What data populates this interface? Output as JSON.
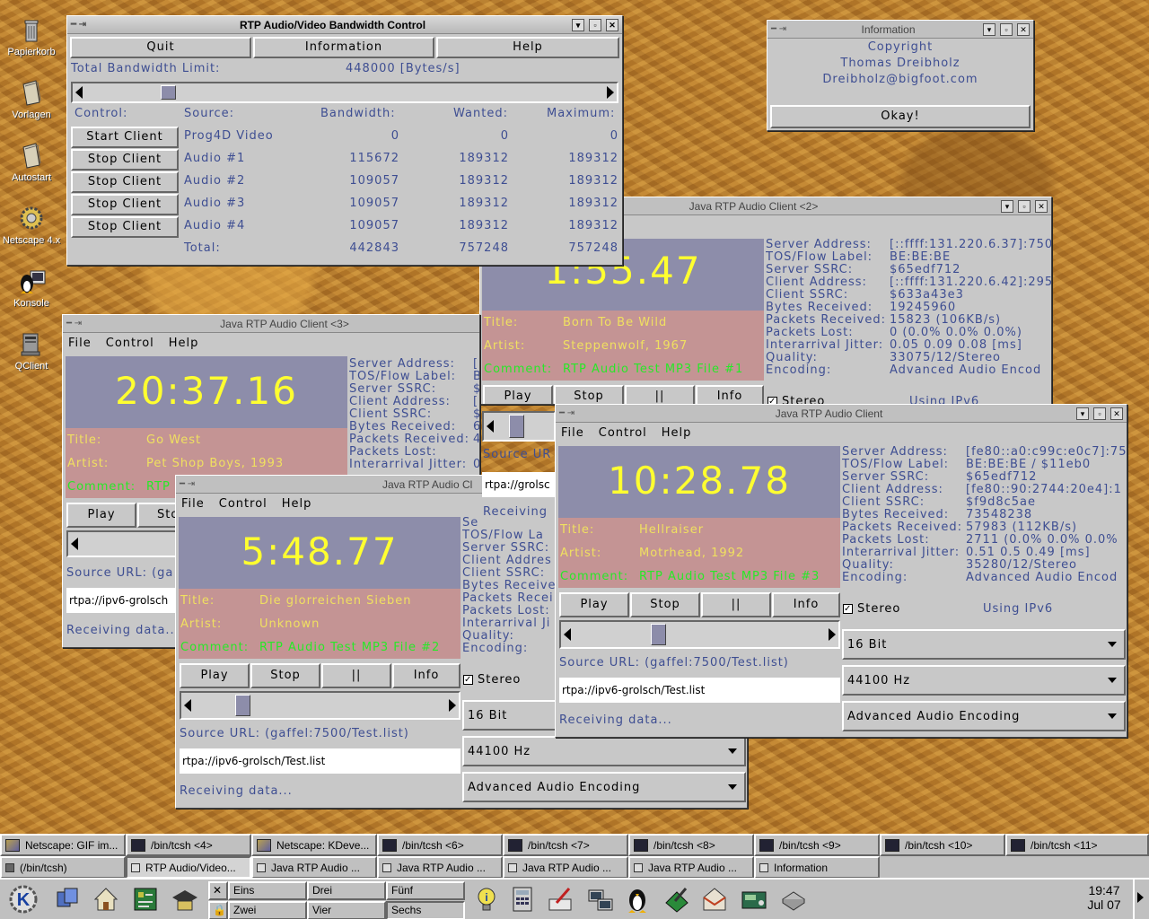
{
  "desktop": {
    "icons": [
      {
        "label": "Papierkorb"
      },
      {
        "label": "Vorlagen"
      },
      {
        "label": "Autostart"
      },
      {
        "label": "Netscape 4.x"
      },
      {
        "label": "Konsole"
      },
      {
        "label": "QClient"
      }
    ]
  },
  "bandwidth": {
    "title": "RTP Audio/Video Bandwidth Control",
    "buttons": {
      "quit": "Quit",
      "information": "Information",
      "help": "Help"
    },
    "limit_label": "Total Bandwidth Limit:",
    "limit_value": "448000 [Bytes/s]",
    "headers": {
      "control": "Control:",
      "source": "Source:",
      "bandwidth": "Bandwidth:",
      "wanted": "Wanted:",
      "maximum": "Maximum:"
    },
    "rows": [
      {
        "button": "Start Client",
        "source": "Prog4D Video",
        "bandwidth": "0",
        "wanted": "0",
        "maximum": "0"
      },
      {
        "button": "Stop Client",
        "source": "Audio #1",
        "bandwidth": "115672",
        "wanted": "189312",
        "maximum": "189312"
      },
      {
        "button": "Stop Client",
        "source": "Audio #2",
        "bandwidth": "109057",
        "wanted": "189312",
        "maximum": "189312"
      },
      {
        "button": "Stop Client",
        "source": "Audio #3",
        "bandwidth": "109057",
        "wanted": "189312",
        "maximum": "189312"
      },
      {
        "button": "Stop Client",
        "source": "Audio #4",
        "bandwidth": "109057",
        "wanted": "189312",
        "maximum": "189312"
      }
    ],
    "total": {
      "label": "Total:",
      "bandwidth": "442843",
      "wanted": "757248",
      "maximum": "757248"
    }
  },
  "information": {
    "title": "Information",
    "lines": [
      "Copyright",
      "Thomas Dreibholz",
      "Dreibholz@bigfoot.com"
    ],
    "ok": "Okay!"
  },
  "menu": {
    "file": "File",
    "control": "Control",
    "help": "Help"
  },
  "controls": {
    "play": "Play",
    "stop": "Stop",
    "pause": "||",
    "info": "Info"
  },
  "meta_keys": {
    "title": "Title:",
    "artist": "Artist:",
    "comment": "Comment:"
  },
  "info_keys": {
    "server_address": "Server Address:",
    "tos": "TOS/Flow Label:",
    "server_ssrc": "Server SSRC:",
    "client_address": "Client Address:",
    "client_ssrc": "Client SSRC:",
    "bytes": "Bytes Received:",
    "packets": "Packets Received:",
    "lost": "Packets Lost:",
    "jitter": "Interarrival Jitter:",
    "quality": "Quality:",
    "encoding": "Encoding:"
  },
  "common": {
    "source_url_label": "Source URL: (gaffel:7500/Test.list)",
    "source_url_label_short": "Source URL: (ga",
    "url": "rtpa://ipv6-grolsch/Test.list",
    "url_short": "rtpa://ipv6-grolsch",
    "url_short2": "rtpa://grolsc",
    "receiving": "Receiving data...",
    "stereo": "Stereo",
    "ipv6": "Using IPv6",
    "bits": "16 Bit",
    "rate": "44100 Hz",
    "encoding": "Advanced Audio Encoding",
    "source_short": "Source UR",
    "receiving_short": "Receiving"
  },
  "client2": {
    "title": "Java RTP Audio Client <2>",
    "time": "1:55.47",
    "song": "Born To Be Wild",
    "artist": "Steppenwolf, 1967",
    "comment": "RTP Audio Test MP3 File #1",
    "server_address": "[::ffff:131.220.6.37]:750",
    "tos": "BE:BE:BE",
    "server_ssrc": "$65edf712",
    "client_address": "[::ffff:131.220.6.42]:295",
    "client_ssrc": "$633a43e3",
    "bytes": "19245960",
    "packets": "15823 (106KB/s)",
    "lost": "0 (0.0% 0.0% 0.0%)",
    "jitter": "0.05 0.09 0.08 [ms]",
    "quality": "33075/12/Stereo",
    "encoding": "Advanced Audio Encod",
    "stereo_short": "Stereo",
    "ipv6_short": "Using IPv6"
  },
  "client3": {
    "title": "Java RTP Audio Client <3>",
    "time": "20:37.16",
    "song": "Go West",
    "artist": "Pet Shop Boys, 1993",
    "comment": "RTP",
    "server_address_frag": "[",
    "tos_frag": "B",
    "server_ssrc_frag": "$",
    "client_address_frag": "[",
    "client_ssrc_frag": "$",
    "bytes_frag": "6",
    "packets_frag": "4",
    "jitter_frag": "0",
    "stop_short": "Sto"
  },
  "client4": {
    "title": "Java RTP Audio Cl",
    "time": "5:48.77",
    "song": "Die glorreichen Sieben",
    "artist": "Unknown",
    "comment": "RTP Audio Test MP3 File #2",
    "keys_frag": {
      "se": "Se",
      "tos": "TOS/Flow La",
      "server_ssrc": "Server SSRC:",
      "client_address": "Client Addres",
      "client_ssrc": "Client SSRC:",
      "bytes": "Bytes Receive",
      "packets": "Packets Recei",
      "lost": "Packets Lost:",
      "jitter": "Interarrival Ji",
      "quality": "Quality:",
      "encoding": "Encoding:"
    }
  },
  "client1": {
    "title": "Java RTP Audio Client",
    "time": "10:28.78",
    "song": "Hellraiser",
    "artist": "Motrhead, 1992",
    "comment": "RTP Audio Test MP3 File #3",
    "server_address": "[fe80::a0:c99c:e0c7]:75",
    "tos": "BE:BE:BE / $11eb0",
    "server_ssrc": "$65edf712",
    "client_address": "[fe80::90:2744:20e4]:1",
    "client_ssrc": "$f9d8c5ae",
    "bytes": "73548238",
    "packets": "57983 (112KB/s)",
    "lost": "2711 (0.0% 0.0% 0.0%",
    "jitter": "0.51 0.5 0.49 [ms]",
    "quality": "35280/12/Stereo",
    "encoding": "Advanced Audio Encod"
  },
  "taskbar": {
    "row1": [
      {
        "label": "Netscape: GIF im...",
        "icon": "netscape-icon"
      },
      {
        "label": "/bin/tcsh <4>",
        "icon": "terminal-icon"
      },
      {
        "label": "Netscape: KDeve...",
        "icon": "netscape-icon"
      },
      {
        "label": "/bin/tcsh <6>",
        "icon": "terminal-icon"
      },
      {
        "label": "/bin/tcsh <7>",
        "icon": "terminal-icon"
      },
      {
        "label": "/bin/tcsh <8>",
        "icon": "terminal-icon"
      },
      {
        "label": "/bin/tcsh <9>",
        "icon": "terminal-icon"
      },
      {
        "label": "/bin/tcsh <10>",
        "icon": "terminal-icon"
      },
      {
        "label": "/bin/tcsh <11>",
        "icon": "terminal-icon"
      }
    ],
    "row2": [
      {
        "label": "(/bin/tcsh)",
        "icon": "terminal-icon"
      },
      {
        "label": "RTP Audio/Video...",
        "icon": "window-icon"
      },
      {
        "label": "Java RTP Audio ...",
        "icon": "window-icon"
      },
      {
        "label": "Java RTP Audio ...",
        "icon": "window-icon"
      },
      {
        "label": "Java RTP Audio ...",
        "icon": "window-icon"
      },
      {
        "label": "Java RTP Audio ...",
        "icon": "window-icon"
      },
      {
        "label": "Information",
        "icon": "window-icon"
      }
    ]
  },
  "panel": {
    "desktops": [
      "Eins",
      "Drei",
      "Fünf",
      "Zwei",
      "Vier",
      "Sechs"
    ],
    "time": "19:47",
    "date": "Jul 07"
  }
}
